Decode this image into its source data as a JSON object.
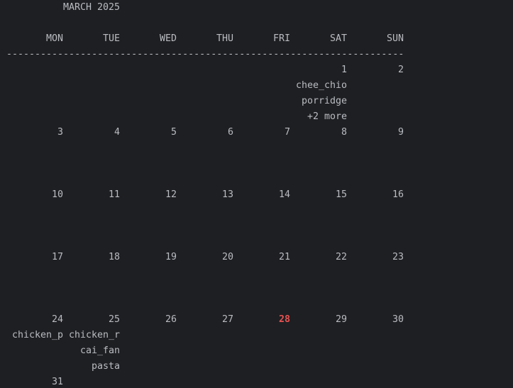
{
  "calendar": {
    "title": "MARCH 2025",
    "weekdays": [
      "MON",
      "TUE",
      "WED",
      "THU",
      "FRI",
      "SAT",
      "SUN"
    ],
    "separator": "----------------------------------------------------------------------",
    "today_color": "#e55353",
    "rows": [
      [
        "",
        "",
        "",
        "",
        "",
        "1",
        "2"
      ],
      [
        "3",
        "4",
        "5",
        "6",
        "7",
        "8",
        "9"
      ],
      [
        "10",
        "11",
        "12",
        "13",
        "14",
        "15",
        "16"
      ],
      [
        "17",
        "18",
        "19",
        "20",
        "21",
        "22",
        "23"
      ],
      [
        "24",
        "25",
        "26",
        "27",
        "28",
        "29",
        "30"
      ],
      [
        "31",
        "",
        "",
        "",
        "",
        "",
        ""
      ]
    ],
    "events": {
      "sat_1": [
        "chee_chio",
        "porridge",
        "+2 more"
      ],
      "mon_24": [
        "chicken_p"
      ],
      "tue_25": [
        "chicken_r",
        "cai_fan",
        "pasta"
      ]
    }
  }
}
